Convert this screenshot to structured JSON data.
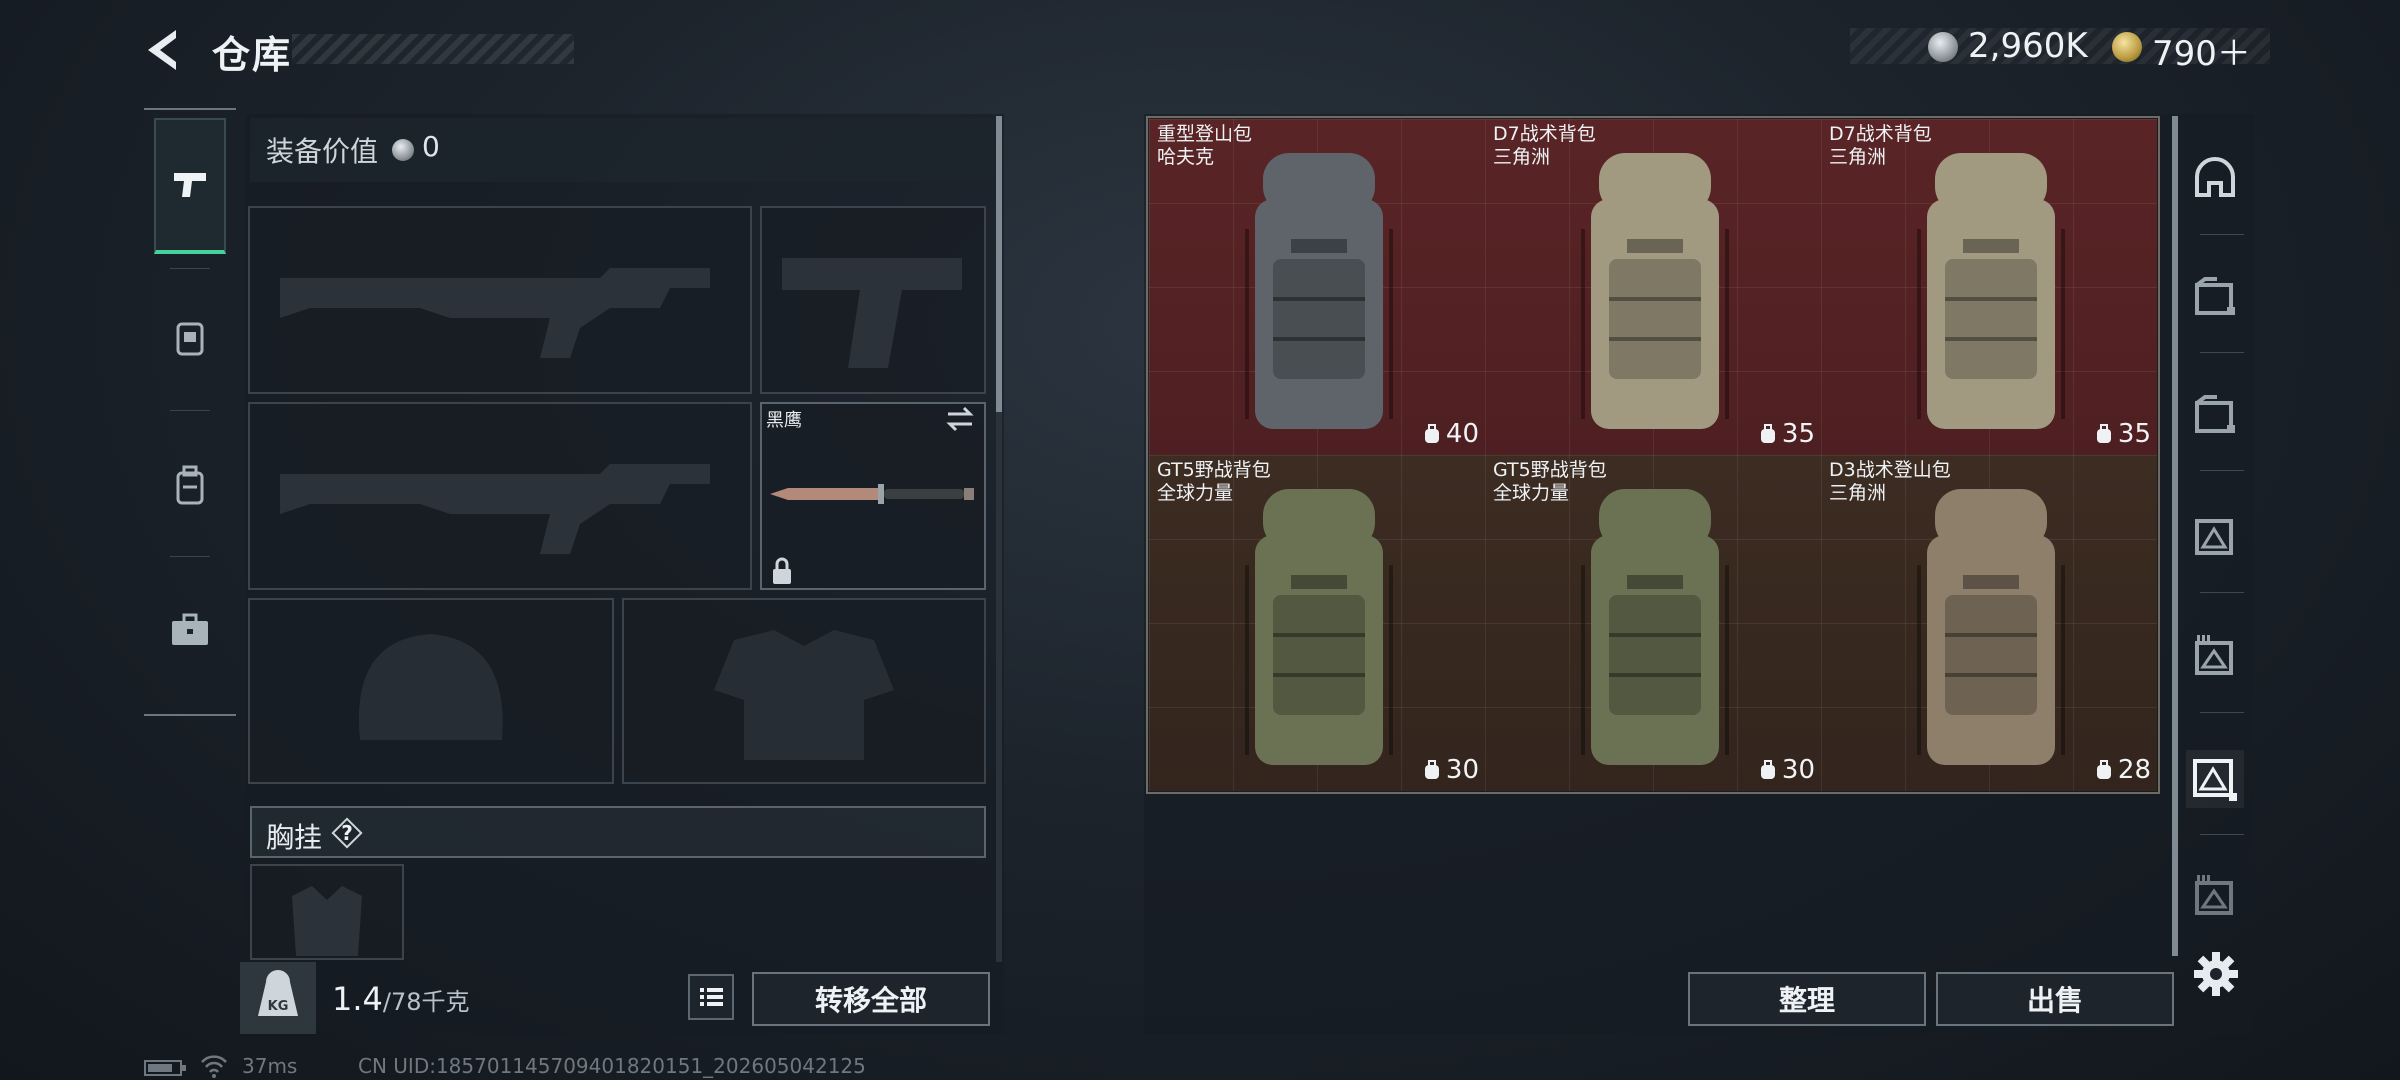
{
  "header": {
    "title": "仓库",
    "currency_silver": "2,960K",
    "currency_gold": "790＋"
  },
  "tabs": [
    {
      "name": "weapon-tab-icon",
      "active": true
    },
    {
      "name": "armor-tab-icon",
      "active": false
    },
    {
      "name": "backpack-tab-icon",
      "active": false
    },
    {
      "name": "toolbox-tab-icon",
      "active": false
    }
  ],
  "equipment": {
    "title": "装备价值",
    "value": "0",
    "knife_name": "黑鹰",
    "chest_rig_label": "胸挂",
    "chest_rig_help": "?"
  },
  "footer_left": {
    "weight_current": "1.4",
    "weight_max": "/78千克",
    "move_all": "转移全部"
  },
  "storage": {
    "items": [
      {
        "name1": "重型登山包",
        "name2": "哈夫克",
        "capacity": "40",
        "bg": "red",
        "pack_color": "#5e646a"
      },
      {
        "name1": "D7战术背包",
        "name2": "三角洲",
        "capacity": "35",
        "bg": "red",
        "pack_color": "#a29a80"
      },
      {
        "name1": "D7战术背包",
        "name2": "三角洲",
        "capacity": "35",
        "bg": "red",
        "pack_color": "#a29a80"
      },
      {
        "name1": "GT5野战背包",
        "name2": "全球力量",
        "capacity": "30",
        "bg": "brown",
        "pack_color": "#6b7254"
      },
      {
        "name1": "GT5野战背包",
        "name2": "全球力量",
        "capacity": "30",
        "bg": "brown",
        "pack_color": "#6b7254"
      },
      {
        "name1": "D3战术登山包",
        "name2": "三角洲",
        "capacity": "28",
        "bg": "brown",
        "pack_color": "#8e7f6a"
      }
    ],
    "sort": "整理",
    "sell": "出售"
  },
  "status": {
    "ping": "37ms",
    "uid": "CN UID:18570114570940182015​1_202605042125"
  }
}
